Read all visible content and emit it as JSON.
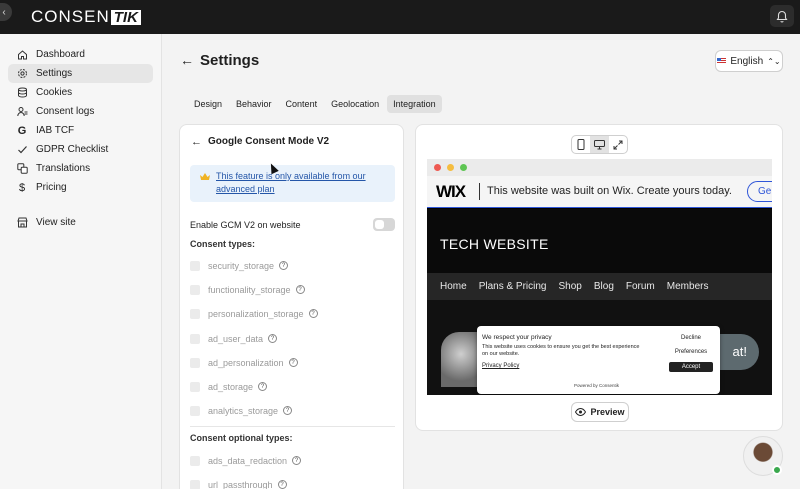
{
  "app": {
    "logo_main": "CONSEN",
    "logo_box": "TIK"
  },
  "sidebar": {
    "items": [
      {
        "label": "Dashboard",
        "icon": "home-icon"
      },
      {
        "label": "Settings",
        "icon": "gear-icon",
        "active": true
      },
      {
        "label": "Cookies",
        "icon": "database-icon"
      },
      {
        "label": "Consent logs",
        "icon": "user-log-icon"
      },
      {
        "label": "IAB TCF",
        "icon": "g-icon"
      },
      {
        "label": "GDPR Checklist",
        "icon": "check-icon"
      },
      {
        "label": "Translations",
        "icon": "translate-icon"
      },
      {
        "label": "Pricing",
        "icon": "dollar-icon"
      }
    ],
    "view_site": {
      "label": "View site",
      "icon": "store-icon"
    }
  },
  "header": {
    "title": "Settings",
    "language": "English"
  },
  "tabs": [
    {
      "label": "Design"
    },
    {
      "label": "Behavior"
    },
    {
      "label": "Content"
    },
    {
      "label": "Geolocation"
    },
    {
      "label": "Integration",
      "active": true
    }
  ],
  "gcm": {
    "title": "Google Consent Mode V2",
    "notice": "This feature is only available from our advanced plan",
    "enable_label": "Enable GCM V2 on website",
    "enabled": false,
    "consent_types_heading": "Consent types:",
    "consent_types": [
      "security_storage",
      "functionality_storage",
      "personalization_storage",
      "ad_user_data",
      "ad_personalization",
      "ad_storage",
      "analytics_storage"
    ],
    "optional_heading": "Consent optional types:",
    "optional_types": [
      "ads_data_redaction",
      "url_passthrough"
    ]
  },
  "preview": {
    "wix_logo": "WIX",
    "wix_banner_text": "This website was built on Wix. Create yours today.",
    "wix_get": "Ge",
    "site_title": "TECH WEBSITE",
    "site_nav": [
      "Home",
      "Plans & Pricing",
      "Shop",
      "Blog",
      "Forum",
      "Members"
    ],
    "hero_button": "at!",
    "cookie": {
      "title": "We respect your privacy",
      "description": "This website uses cookies to ensure you get the best experience on our website.",
      "privacy_link": "Privacy Policy",
      "decline": "Decline",
      "preferences": "Preferences",
      "accept": "Accept",
      "powered": "Powered by Consentik"
    },
    "preview_button": "Preview"
  },
  "colors": {
    "accent_link": "#2456a8",
    "wix_blue": "#2f56d8",
    "online": "#3aa84d"
  }
}
